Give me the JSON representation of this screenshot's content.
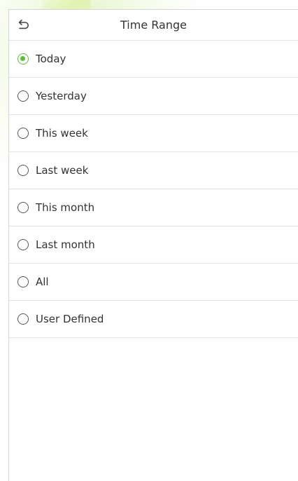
{
  "header": {
    "back_icon": "back-arrow-icon",
    "title": "Time Range"
  },
  "options": [
    {
      "label": "Today",
      "selected": true
    },
    {
      "label": "Yesterday",
      "selected": false
    },
    {
      "label": "This week",
      "selected": false
    },
    {
      "label": "Last week",
      "selected": false
    },
    {
      "label": "This month",
      "selected": false
    },
    {
      "label": "Last month",
      "selected": false
    },
    {
      "label": "All",
      "selected": false
    },
    {
      "label": "User Defined",
      "selected": false
    }
  ],
  "colors": {
    "accent": "#5cbf3a",
    "text": "#333333",
    "divider": "#e3e3e3"
  }
}
